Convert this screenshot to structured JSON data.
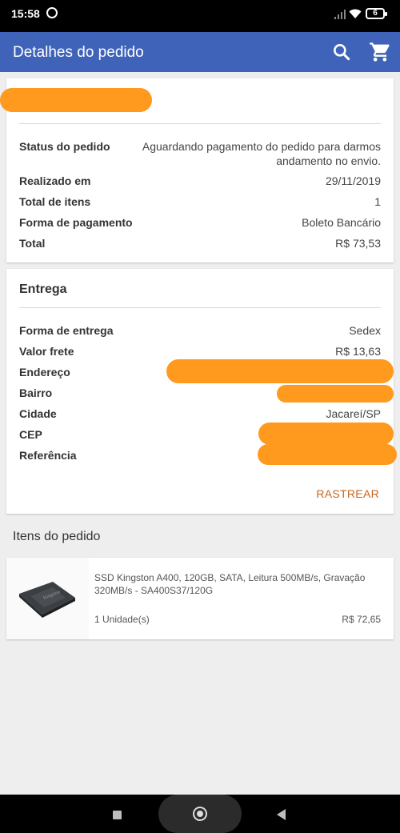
{
  "status_bar": {
    "time": "15:58",
    "battery": "6",
    "icons": [
      "whatsapp-icon",
      "signal-icon",
      "wifi-icon",
      "battery-icon"
    ]
  },
  "app_bar": {
    "title": "Detalhes do pedido",
    "icons": [
      "search-icon",
      "cart-icon"
    ],
    "color": "#3f63b9"
  },
  "order": {
    "rows": [
      {
        "label": "Status do pedido",
        "value_line1": "Aguardando pagamento do pedido para darmos",
        "value_line2": "andamento no envio."
      },
      {
        "label": "Realizado em",
        "value": "29/11/2019"
      },
      {
        "label": "Total de itens",
        "value": "1"
      },
      {
        "label": "Forma de pagamento",
        "value": "Boleto Bancário"
      },
      {
        "label": "Total",
        "value": "R$ 73,53"
      }
    ]
  },
  "delivery": {
    "title": "Entrega",
    "rows": [
      {
        "label": "Forma de entrega",
        "value": "Sedex"
      },
      {
        "label": "Valor frete",
        "value": "R$ 13,63"
      },
      {
        "label": "Endereço",
        "value": ""
      },
      {
        "label": "Bairro",
        "value": ""
      },
      {
        "label": "Cidade",
        "value": "Jacareí/SP"
      },
      {
        "label": "CEP",
        "value": ""
      },
      {
        "label": "Referência",
        "value": ""
      }
    ],
    "track_label": "RASTREAR",
    "track_color": "#c5671d"
  },
  "items": {
    "title": "Itens do pedido",
    "list": [
      {
        "name": "SSD Kingston A400, 120GB, SATA, Leitura 500MB/s, Gravação 320MB/s - SA400S37/120G",
        "quantity": "1 Unidade(s)",
        "price": "R$ 72,65",
        "image": "ssd-thumbnail"
      }
    ]
  },
  "redaction_color": "#ff9a1f",
  "nav_bar": {
    "icons": [
      "recents-icon",
      "home-icon",
      "back-icon"
    ]
  }
}
